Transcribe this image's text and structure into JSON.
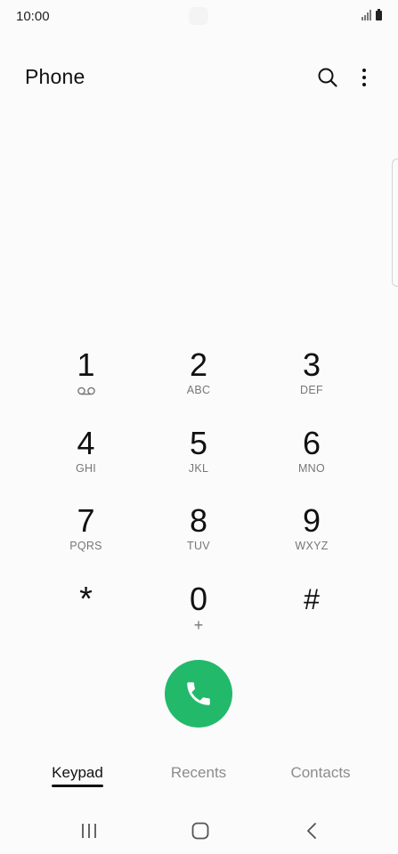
{
  "status_bar": {
    "time": "10:00"
  },
  "header": {
    "title": "Phone",
    "search_icon": "search-icon",
    "more_icon": "more-vertical-icon"
  },
  "keypad": {
    "keys": [
      {
        "digit": "1",
        "letters": "",
        "sub_icon": "voicemail-icon"
      },
      {
        "digit": "2",
        "letters": "ABC"
      },
      {
        "digit": "3",
        "letters": "DEF"
      },
      {
        "digit": "4",
        "letters": "GHI"
      },
      {
        "digit": "5",
        "letters": "JKL"
      },
      {
        "digit": "6",
        "letters": "MNO"
      },
      {
        "digit": "7",
        "letters": "PQRS"
      },
      {
        "digit": "8",
        "letters": "TUV"
      },
      {
        "digit": "9",
        "letters": "WXYZ"
      },
      {
        "digit": "*",
        "letters": ""
      },
      {
        "digit": "0",
        "letters": "+"
      },
      {
        "digit": "#",
        "letters": ""
      }
    ]
  },
  "call_button": {
    "icon": "phone-icon",
    "color": "#22b96b"
  },
  "tabs": [
    {
      "label": "Keypad",
      "active": true
    },
    {
      "label": "Recents",
      "active": false
    },
    {
      "label": "Contacts",
      "active": false
    }
  ],
  "nav_bar": {
    "recents_icon": "recent-apps-icon",
    "home_icon": "home-icon",
    "back_icon": "back-icon"
  }
}
